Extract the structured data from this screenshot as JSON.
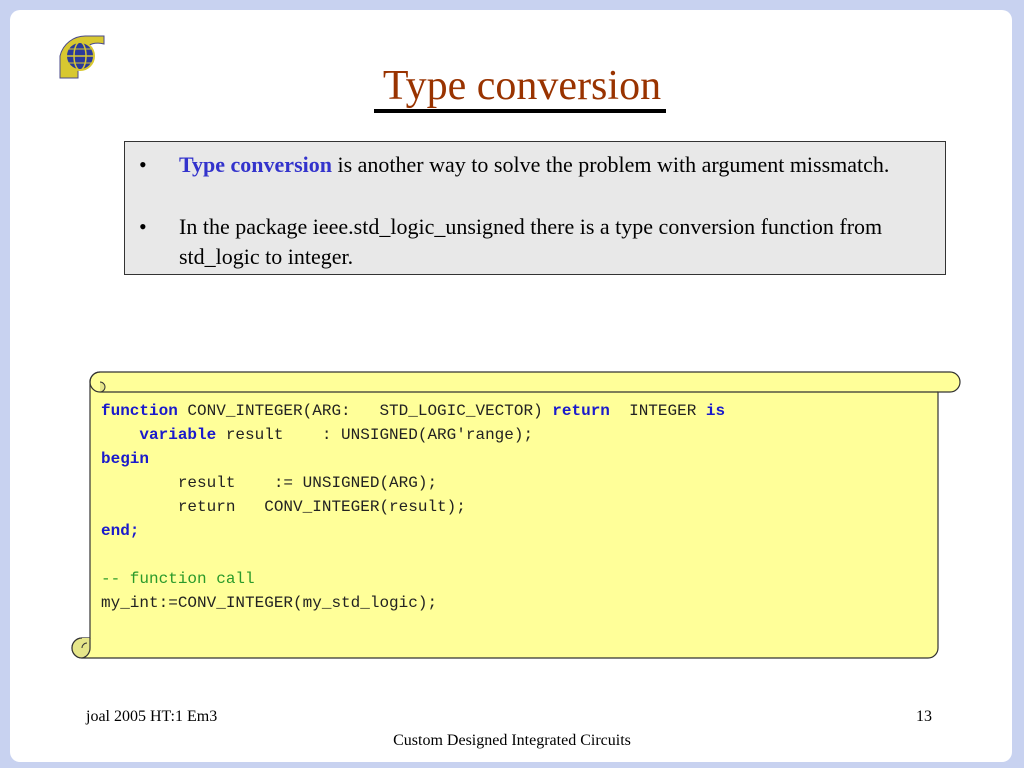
{
  "logo": {
    "icon": "globe-logo-icon"
  },
  "title": "Type conversion",
  "bullets": [
    {
      "highlight": "Type conversion",
      "text": " is another way to solve the problem with argument missmatch."
    },
    {
      "highlight": "",
      "text": "In the package ieee.std_logic_unsigned there is a type conversion function from std_logic to integer."
    }
  ],
  "code": {
    "line1_kw1": "function",
    "line1_text": " CONV_INTEGER(ARG:   STD_LOGIC_VECTOR) ",
    "line1_kw2": "return",
    "line1_text2": "  INTEGER ",
    "line1_kw3": "is",
    "line2_kw": "variable",
    "line2_text": " result    : UNSIGNED(ARG'range);",
    "line3_kw": "begin",
    "line4_text": "        result    := UNSIGNED(ARG);",
    "line5_text": "        return   CONV_INTEGER(result);",
    "line6_kw": "end;",
    "line8_comment": "-- function call",
    "line9_text": "my_int:=CONV_INTEGER(my_std_logic);"
  },
  "footer": {
    "left": "joal 2005 HT:1 Em3",
    "right": "13",
    "center": "Custom Designed Integrated Circuits"
  },
  "colors": {
    "title": "#993300",
    "highlight": "#3333cc",
    "keyword": "#1a1acc",
    "comment": "#2a9a2a",
    "scroll_fill": "#ffff99",
    "bullet_box": "#e8e8e8"
  }
}
